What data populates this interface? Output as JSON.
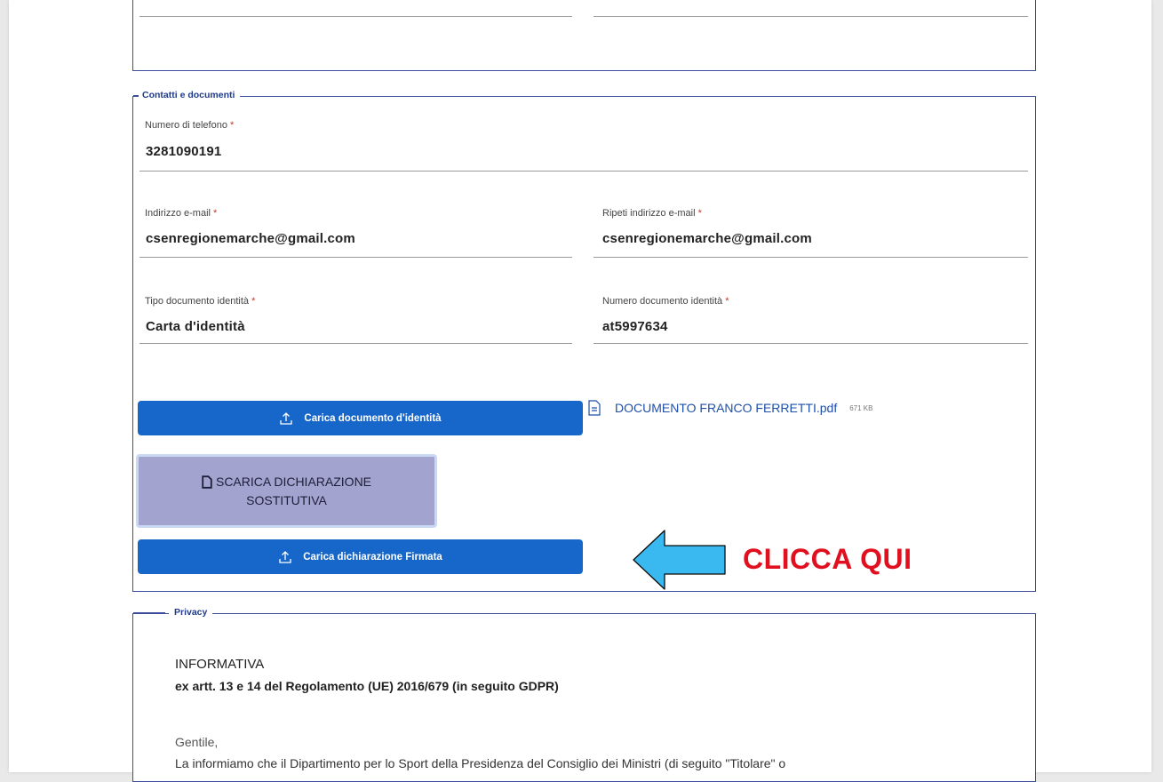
{
  "contacts": {
    "legend": "Contatti e documenti",
    "phone": {
      "label": "Numero di telefono",
      "value": "3281090191"
    },
    "email": {
      "label": "Indirizzo e-mail",
      "value": "csenregionemarche@gmail.com"
    },
    "email_repeat": {
      "label": "Ripeti indirizzo e-mail",
      "value": "csenregionemarche@gmail.com"
    },
    "doc_type": {
      "label": "Tipo documento identità",
      "value": "Carta d'identità"
    },
    "doc_number": {
      "label": "Numero documento identità",
      "value": "at5997634"
    },
    "required_mark": "*",
    "upload_id_button": "Carica documento d'identità",
    "uploaded_file": {
      "name": "DOCUMENTO FRANCO FERRETTI.pdf",
      "size": "671 KB"
    },
    "download_declaration_line1": "SCARICA DICHIARAZIONE",
    "download_declaration_line2": "SOSTITUTIVA",
    "upload_signed_button": "Carica dichiarazione Firmata"
  },
  "callout": {
    "text": "CLICCA QUI",
    "arrow_color": "#3ab8f0",
    "text_color": "#e0101f"
  },
  "privacy": {
    "legend": "Privacy",
    "title": "INFORMATIVA",
    "subtitle": "ex artt. 13 e 14 del Regolamento (UE) 2016/679 (in seguito GDPR)",
    "greeting": "Gentile,",
    "body": "La informiamo che il Dipartimento per lo Sport della Presidenza del Consiglio dei Ministri (di seguito \"Titolare\" o"
  },
  "colors": {
    "accent": "#1766c9",
    "border": "#3b4d9c"
  }
}
